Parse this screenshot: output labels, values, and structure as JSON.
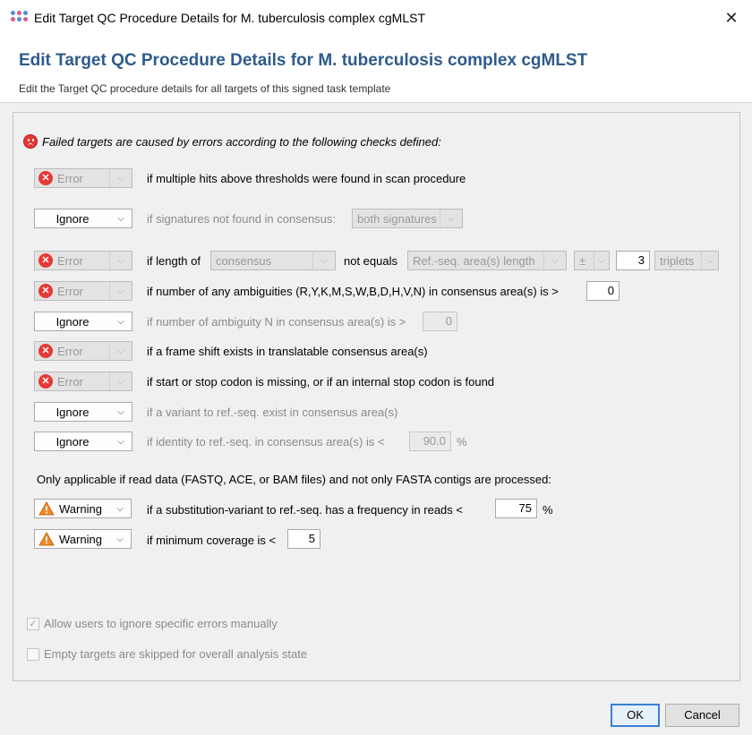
{
  "window": {
    "title": "Edit Target QC Procedure Details for M. tuberculosis complex cgMLST",
    "close_glyph": "✕"
  },
  "header": {
    "title": "Edit Target QC Procedure Details for M. tuberculosis complex cgMLST",
    "subtitle": "Edit the Target QC procedure details for all targets of this signed task template"
  },
  "intro": "Failed targets are caused by errors according to the following checks defined:",
  "checks": {
    "multiple_hits": {
      "severity": "Error",
      "text": "if multiple hits above thresholds were found in scan procedure"
    },
    "signatures": {
      "severity": "Ignore",
      "text": "if signatures not found in consensus:",
      "option": "both signatures"
    },
    "length": {
      "severity": "Error",
      "prefix": "if length of",
      "source": "consensus",
      "middle": "not equals",
      "target": "Ref.-seq. area(s) length",
      "pm": "±",
      "value": "3",
      "unit": "triplets"
    },
    "ambiguities": {
      "severity": "Error",
      "text": "if number of any ambiguities (R,Y,K,M,S,W,B,D,H,V,N) in consensus area(s) is >",
      "value": "0"
    },
    "ambiguity_n": {
      "severity": "Ignore",
      "text": "if number of ambiguity N in consensus area(s) is >",
      "value": "0"
    },
    "frame_shift": {
      "severity": "Error",
      "text": "if a frame shift exists in translatable consensus area(s)"
    },
    "codon": {
      "severity": "Error",
      "text": "if start or stop codon is missing, or if an internal stop codon is found"
    },
    "variant": {
      "severity": "Ignore",
      "text": "if a variant to ref.-seq. exist in consensus area(s)"
    },
    "identity": {
      "severity": "Ignore",
      "text": "if identity to ref.-seq. in consensus area(s) is <",
      "value": "90.0",
      "unit": "%"
    }
  },
  "read_data_note": "Only applicable if read data (FASTQ, ACE, or BAM files) and not only FASTA contigs are processed:",
  "read_checks": {
    "substitution": {
      "severity": "Warning",
      "text": "if a substitution-variant to ref.-seq. has a frequency in reads <",
      "value": "75",
      "unit": "%"
    },
    "coverage": {
      "severity": "Warning",
      "text": "if minimum coverage is <",
      "value": "5"
    }
  },
  "options": {
    "allow_ignore": {
      "label": "Allow users to ignore specific errors manually",
      "checked": true
    },
    "skip_empty": {
      "label": "Empty targets are skipped for overall analysis state",
      "checked": false
    }
  },
  "buttons": {
    "ok": "OK",
    "cancel": "Cancel"
  },
  "icons": {
    "error_glyph": "✕",
    "check_glyph": "✓",
    "dropdown_glyph": "⌵"
  },
  "colors": {
    "title_blue": "#2f5b8c",
    "error_red": "#e53935",
    "warning_orange": "#f0892a",
    "ok_border": "#3c7fd6"
  }
}
